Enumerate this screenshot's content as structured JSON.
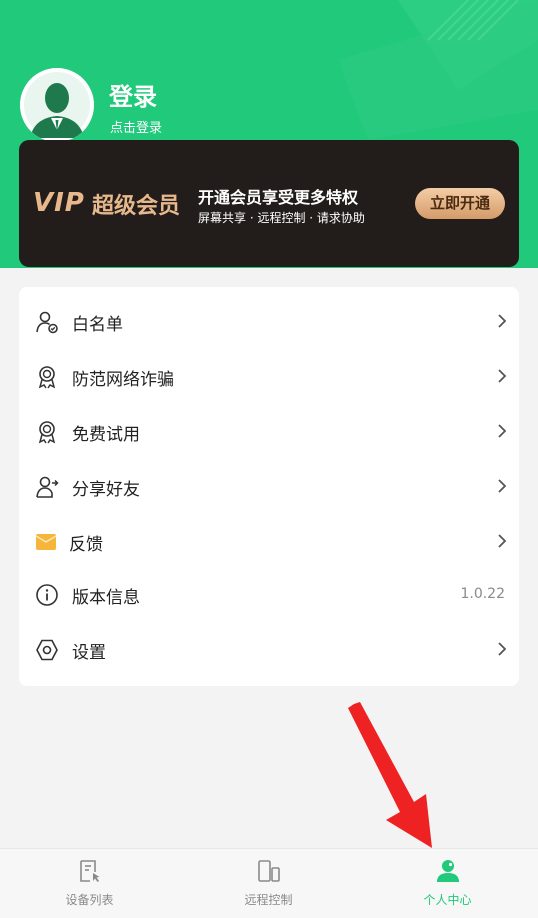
{
  "profile": {
    "title": "登录",
    "subtitle": "点击登录"
  },
  "vip": {
    "logo": "VIP",
    "name": "超级会员",
    "headline": "开通会员享受更多特权",
    "perks": "屏幕共享 · 远程控制 · 请求协助",
    "button": "立即开通"
  },
  "menu": {
    "items": [
      {
        "label": "白名单",
        "icon": "user-check-icon"
      },
      {
        "label": "防范网络诈骗",
        "icon": "badge-award-icon"
      },
      {
        "label": "免费试用",
        "icon": "badge-award-icon"
      },
      {
        "label": "分享好友",
        "icon": "user-share-icon"
      },
      {
        "label": "反馈",
        "icon": "envelope-icon"
      },
      {
        "label": "版本信息",
        "icon": "info-icon",
        "value": "1.0.22"
      },
      {
        "label": "设置",
        "icon": "hexagon-settings-icon"
      }
    ]
  },
  "nav": {
    "tabs": [
      {
        "label": "设备列表",
        "icon": "device-list-icon"
      },
      {
        "label": "远程控制",
        "icon": "remote-control-icon"
      },
      {
        "label": "个人中心",
        "icon": "person-icon",
        "active": true
      }
    ]
  },
  "colors": {
    "brand_green": "#21c97b",
    "vip_gold": "#e8b88d",
    "vip_bg": "#221d1b",
    "annotation_red": "#ee2222"
  }
}
